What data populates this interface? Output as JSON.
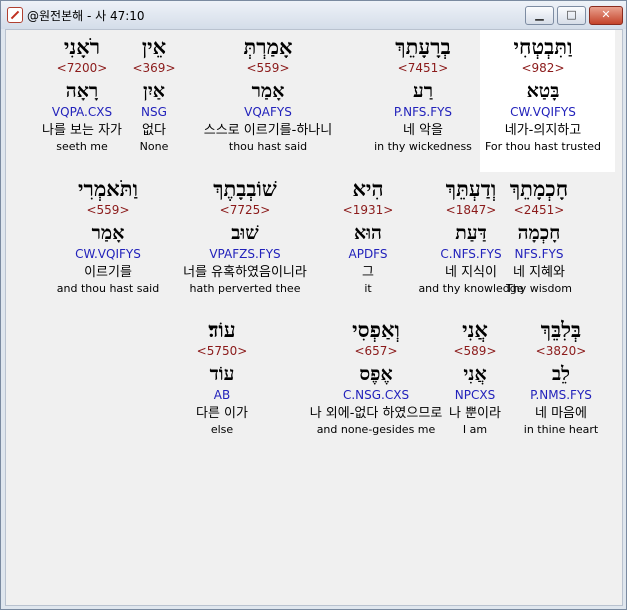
{
  "window": {
    "title": "@원전본해 - 사 47:10",
    "buttons": {
      "minimize": "▁",
      "maximize": "□",
      "close": "✕"
    }
  },
  "rows": [
    {
      "words": [
        {
          "hebrew": "וַתִּבְטְחִי",
          "strong": "<982>",
          "lemma": "בָּטַא",
          "morph": "CW.VQIFYS",
          "korean": "네가-의지하고",
          "english": "For thou hast trusted",
          "highlighted": true
        },
        {
          "hebrew": "בְרָעָתֵךְ",
          "strong": "<7451>",
          "lemma": "רַע",
          "morph": "P.NFS.FYS",
          "korean": "네 악을",
          "english": "in thy wickedness"
        },
        {
          "hebrew": "אָמַרְתְּ",
          "strong": "<559>",
          "lemma": "אָמַר",
          "morph": "VQAFYS",
          "korean": "스스로 이르기를-하나니",
          "english": "thou hast said"
        },
        {
          "hebrew": "אֵין",
          "strong": "<369>",
          "lemma": "אַיִן",
          "morph": "NSG",
          "korean": "없다",
          "english": "None"
        },
        {
          "hebrew": "רֹאָנִי",
          "strong": "<7200>",
          "lemma": "רָאָה",
          "morph": "VQPA.CXS",
          "korean": "나를 보는 자가",
          "english": "seeth me"
        }
      ]
    },
    {
      "words": [
        {
          "hebrew": "חָכְמָתֵךְ",
          "strong": "<2451>",
          "lemma": "חָכְמָה",
          "morph": "NFS.FYS",
          "korean": "네 지혜와",
          "english": "Thy wisdom"
        },
        {
          "hebrew": "וְדַעְתֵּךְ",
          "strong": "<1847>",
          "lemma": "דַּעַת",
          "morph": "C.NFS.FYS",
          "korean": "네 지식이",
          "english": "and thy knowledge"
        },
        {
          "hebrew": "הִיא",
          "strong": "<1931>",
          "lemma": "הוּא",
          "morph": "APDFS",
          "korean": "그",
          "english": "it"
        },
        {
          "hebrew": "שׁוֹבְבָתֶךְ",
          "strong": "<7725>",
          "lemma": "שׁוּב",
          "morph": "VPAFZS.FYS",
          "korean": "너를 유혹하였음이니라",
          "english": "hath perverted thee"
        },
        {
          "hebrew": "וַתֹּאמְרִי",
          "strong": "<559>",
          "lemma": "אָמַר",
          "morph": "CW.VQIFYS",
          "korean": "이르기를",
          "english": "and thou hast said"
        }
      ]
    },
    {
      "words": [
        {
          "hebrew": "בְּלִבֵּךְ",
          "strong": "<3820>",
          "lemma": "לֵב",
          "morph": "P.NMS.FYS",
          "korean": "네 마음에",
          "english": "in thine heart"
        },
        {
          "hebrew": "אֲנִי",
          "strong": "<589>",
          "lemma": "אֲנִי",
          "morph": "NPCXS",
          "korean": "나 뿐이라",
          "english": "I am"
        },
        {
          "hebrew": "וְאַפְסִי",
          "strong": "<657>",
          "lemma": "אֶפֶס",
          "morph": "C.NSG.CXS",
          "korean": "나 외에-없다 하였으므로",
          "english": "and none-gesides me"
        },
        {
          "hebrew": "עוֹד׃",
          "strong": "<5750>",
          "lemma": "עוֹד",
          "morph": "AB",
          "korean": "다른 이가",
          "english": "else"
        }
      ]
    }
  ]
}
